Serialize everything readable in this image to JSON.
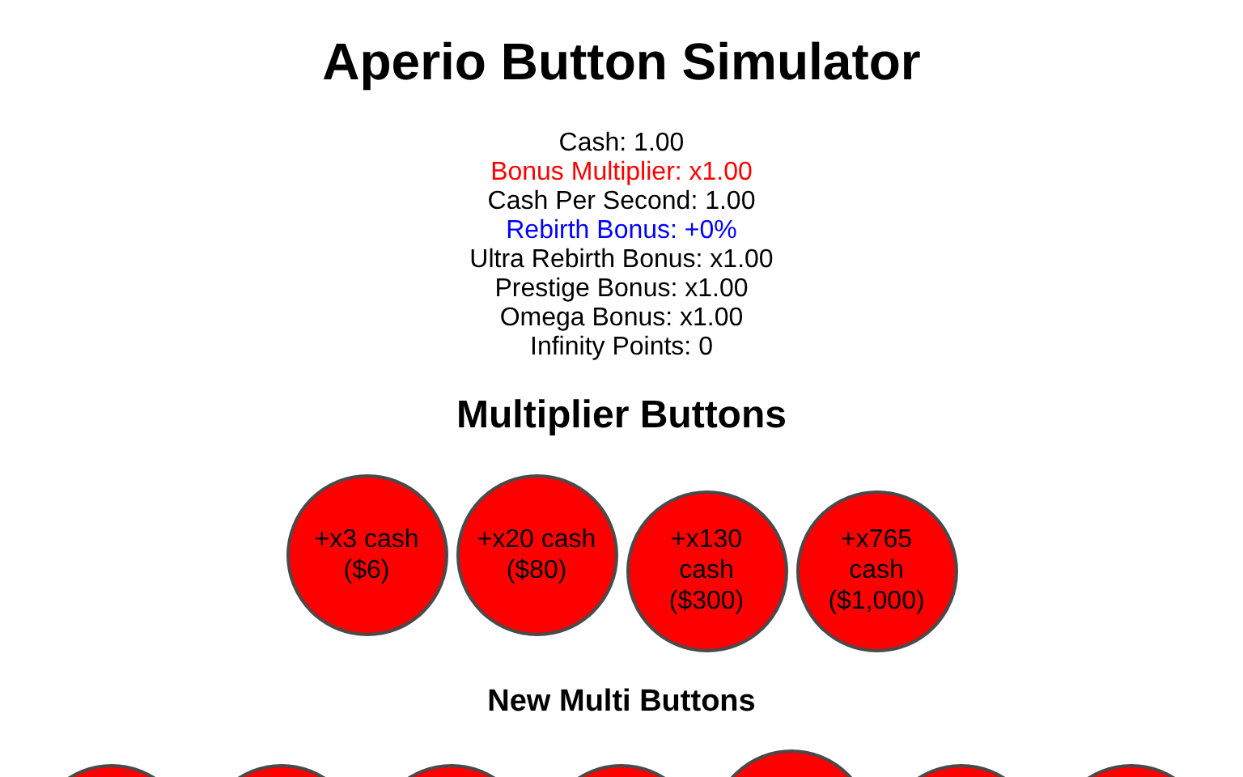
{
  "title": "Aperio Button Simulator",
  "stats": [
    {
      "text": "Cash: 1.00",
      "color": "#000000"
    },
    {
      "text": "Bonus Multiplier: x1.00",
      "color": "#ff0000"
    },
    {
      "text": "Cash Per Second: 1.00",
      "color": "#000000"
    },
    {
      "text": "Rebirth Bonus: +0%",
      "color": "#0000ff"
    },
    {
      "text": "Ultra Rebirth Bonus: x1.00",
      "color": "#000000"
    },
    {
      "text": "Prestige Bonus: x1.00",
      "color": "#000000"
    },
    {
      "text": "Omega Bonus: x1.00",
      "color": "#000000"
    },
    {
      "text": "Infinity Points: 0",
      "color": "#000000"
    }
  ],
  "multiplier_section": {
    "heading": "Multiplier Buttons",
    "buttons": [
      {
        "label": "+x3 cash ($6)"
      },
      {
        "label": "+x20 cash ($80)"
      },
      {
        "label": "+x130 cash ($300)"
      },
      {
        "label": "+x765 cash ($1,000)"
      }
    ]
  },
  "new_multi_section": {
    "heading": "New Multi Buttons",
    "buttons": [
      {
        "kind": "circle"
      },
      {
        "kind": "circle"
      },
      {
        "kind": "circle"
      },
      {
        "kind": "circle"
      },
      {
        "kind": "raised"
      },
      {
        "kind": "circle"
      },
      {
        "kind": "circle"
      }
    ]
  }
}
